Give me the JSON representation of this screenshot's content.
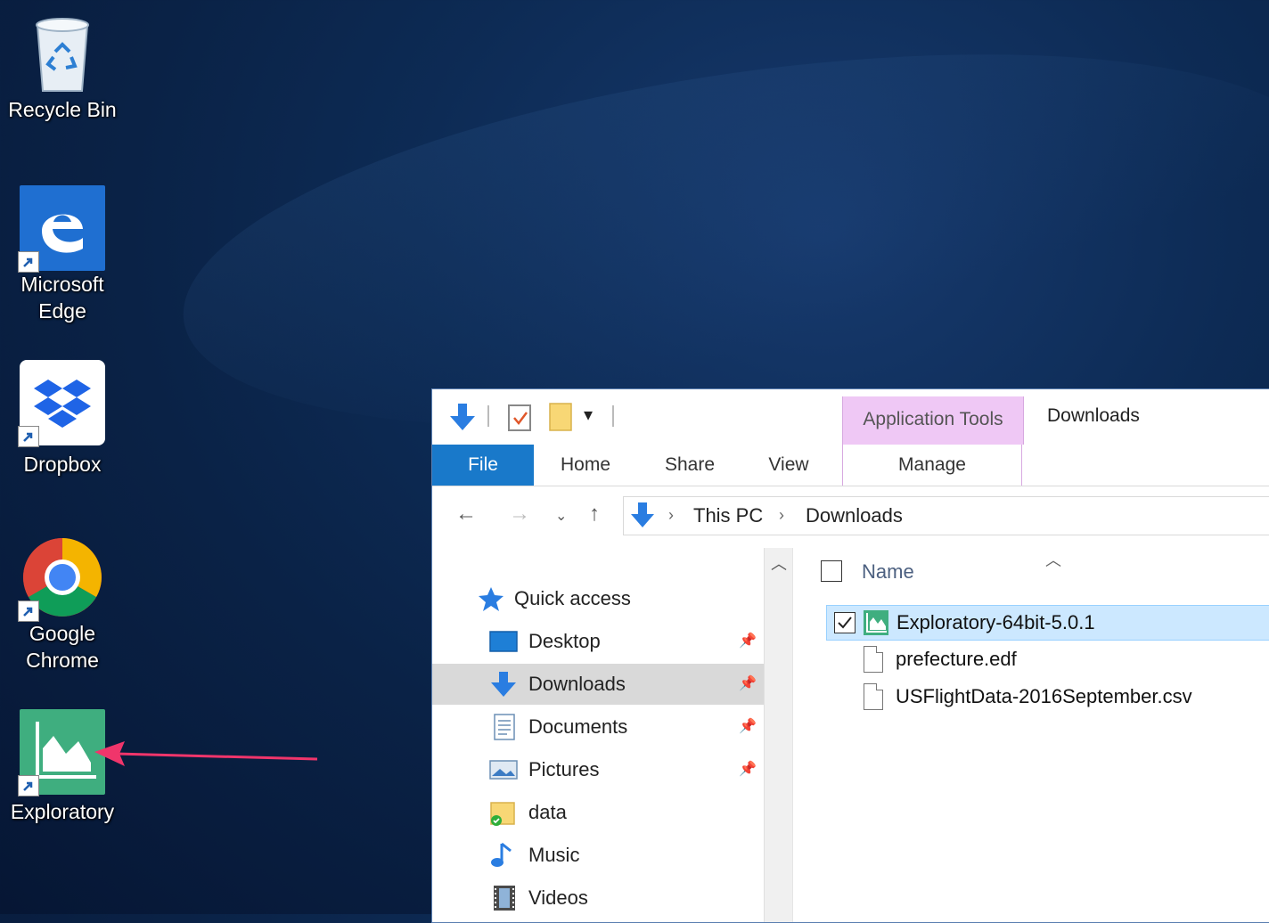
{
  "desktop": {
    "icons": [
      {
        "label": "Recycle Bin",
        "icon": "recycle-bin-icon"
      },
      {
        "label_line1": "Microsoft",
        "label_line2": "Edge",
        "icon": "edge-icon"
      },
      {
        "label": "Dropbox",
        "icon": "dropbox-icon"
      },
      {
        "label_line1": "Google",
        "label_line2": "Chrome",
        "icon": "chrome-icon"
      },
      {
        "label": "Exploratory",
        "icon": "exploratory-icon"
      }
    ],
    "annotation_arrow_color": "#f0356b"
  },
  "explorer": {
    "title": "Downloads",
    "context_group": "Application Tools",
    "context_color": "#efc8f5",
    "tabs": [
      {
        "label": "File"
      },
      {
        "label": "Home"
      },
      {
        "label": "Share"
      },
      {
        "label": "View"
      },
      {
        "label": "Manage"
      }
    ],
    "breadcrumb": [
      "This PC",
      "Downloads"
    ],
    "nav": [
      {
        "label": "Quick access",
        "icon": "star-icon"
      },
      {
        "label": "Desktop",
        "icon": "desktop-folder-icon",
        "pinned": true
      },
      {
        "label": "Downloads",
        "icon": "downloads-arrow-icon",
        "pinned": true,
        "selected": true
      },
      {
        "label": "Documents",
        "icon": "documents-icon",
        "pinned": true
      },
      {
        "label": "Pictures",
        "icon": "pictures-icon",
        "pinned": true
      },
      {
        "label": "data",
        "icon": "folder-sync-icon"
      },
      {
        "label": "Music",
        "icon": "music-note-icon"
      },
      {
        "label": "Videos",
        "icon": "videos-film-icon"
      }
    ],
    "column_name": "Name",
    "files": [
      {
        "name": "Exploratory-64bit-5.0.1",
        "selected": true,
        "checked": true,
        "icon": "exploratory-app-icon"
      },
      {
        "name": "prefecture.edf",
        "icon": "document-icon"
      },
      {
        "name": "USFlightData-2016September.csv",
        "icon": "document-icon"
      }
    ],
    "accent": "#1979ca"
  }
}
